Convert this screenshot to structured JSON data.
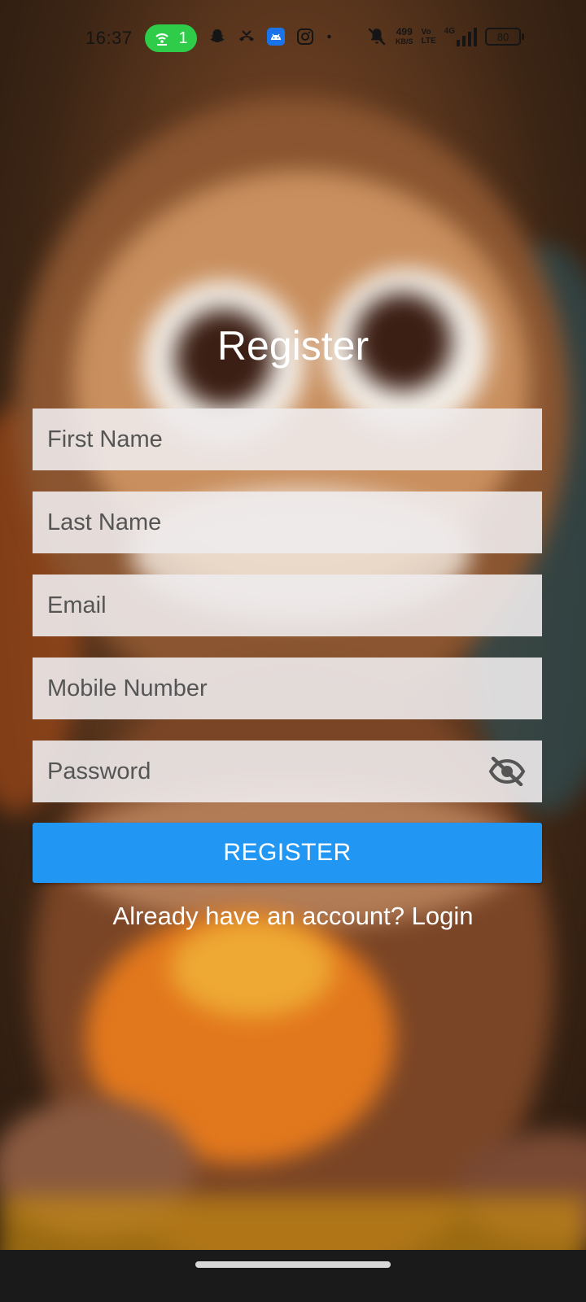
{
  "status_bar": {
    "time": "16:37",
    "hotspot_count": "1",
    "hotspot_color": "#2ecc49",
    "icons": [
      "hotspot-icon",
      "snapchat-icon",
      "missed-call-icon",
      "android-app-icon",
      "instagram-icon",
      "dot-icon",
      "mute-icon"
    ],
    "net_speed_value": "499",
    "net_speed_unit": "KB/S",
    "volte_top": "Vo",
    "volte_bottom": "LTE",
    "network_type": "4G",
    "battery": "80"
  },
  "form": {
    "title": "Register",
    "fields": [
      {
        "name": "first-name-field",
        "placeholder": "First Name",
        "type": "text"
      },
      {
        "name": "last-name-field",
        "placeholder": "Last Name",
        "type": "text"
      },
      {
        "name": "email-field",
        "placeholder": "Email",
        "type": "email"
      },
      {
        "name": "mobile-number-field",
        "placeholder": "Mobile Number",
        "type": "tel"
      },
      {
        "name": "password-field",
        "placeholder": "Password",
        "type": "password"
      }
    ],
    "password_toggle_icon": "eye-off-icon",
    "register_button": "REGISTER",
    "login_prompt": "Already have an account? Login"
  },
  "colors": {
    "accent": "#2196f3",
    "field_bg": "#eeebec",
    "text_light": "#ffffff"
  }
}
